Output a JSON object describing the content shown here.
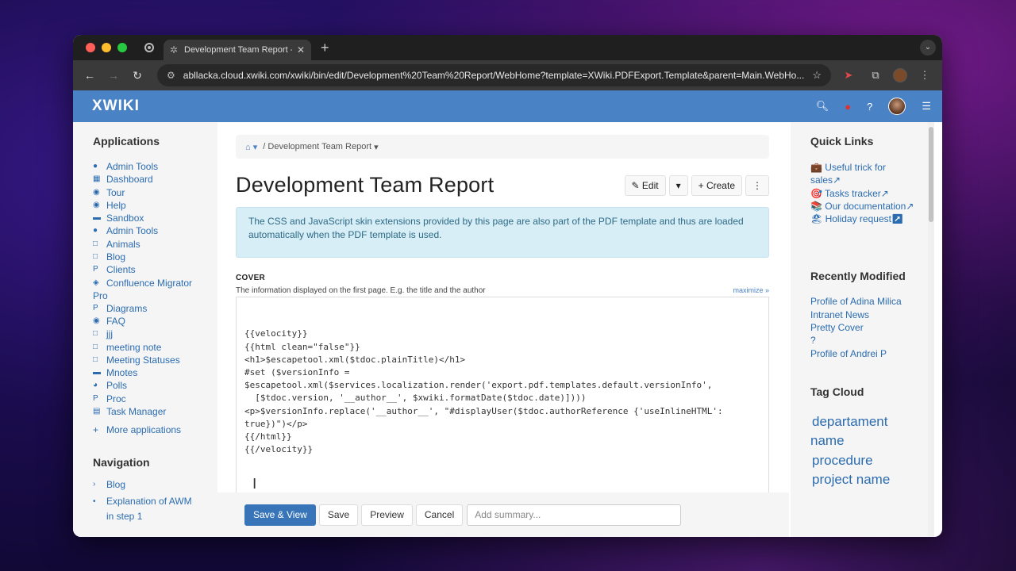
{
  "browser": {
    "tab_title": "Development Team Report - X",
    "new_tab": "+",
    "url": "abllacka.cloud.xwiki.com/xwiki/bin/edit/Development%20Team%20Report/WebHome?template=XWiki.PDFExport.Template&parent=Main.WebHo..."
  },
  "header": {
    "logo": "XWIKI"
  },
  "sidebar": {
    "applications_title": "Applications",
    "applications": [
      {
        "icon": "globe-icon",
        "label": "Admin Tools"
      },
      {
        "icon": "dashboard-icon",
        "label": "Dashboard"
      },
      {
        "icon": "tour-icon",
        "label": "Tour"
      },
      {
        "icon": "help-icon",
        "label": "Help"
      },
      {
        "icon": "sandbox-icon",
        "label": "Sandbox"
      },
      {
        "icon": "globe-icon",
        "label": "Admin Tools"
      },
      {
        "icon": "square-icon",
        "label": "Animals"
      },
      {
        "icon": "blog-icon",
        "label": "Blog"
      },
      {
        "icon": "p-icon",
        "label": "Clients"
      },
      {
        "icon": "confluence-icon",
        "label": "Confluence Migrator Pro"
      },
      {
        "icon": "p-icon",
        "label": "Diagrams"
      },
      {
        "icon": "faq-icon",
        "label": "FAQ"
      },
      {
        "icon": "square-icon",
        "label": "jjj"
      },
      {
        "icon": "square-icon",
        "label": "meeting note"
      },
      {
        "icon": "square-icon",
        "label": "Meeting Statuses"
      },
      {
        "icon": "mnotes-icon",
        "label": "Mnotes"
      },
      {
        "icon": "polls-icon",
        "label": "Polls"
      },
      {
        "icon": "p-icon",
        "label": "Proc"
      },
      {
        "icon": "task-icon",
        "label": "Task Manager"
      }
    ],
    "more_applications": "More applications",
    "navigation_title": "Navigation",
    "navigation": [
      "Blog",
      "Explanation of AWM in step 1"
    ]
  },
  "main": {
    "breadcrumb": "Development Team Report",
    "title": "Development Team Report",
    "edit": "Edit",
    "create": "Create",
    "notice": "The CSS and JavaScript skin extensions provided by this page are also part of the PDF template and thus are loaded automatically when the PDF template is used.",
    "section_title": "COVER",
    "section_desc": "The information displayed on the first page. E.g. the title and the author",
    "maximize": "maximize »",
    "code": "{{velocity}}\n{{html clean=\"false\"}}\n<h1>$escapetool.xml($tdoc.plainTitle)</h1>\n#set ($versionInfo =\n$escapetool.xml($services.localization.render('export.pdf.templates.default.versionInfo',\n  [$tdoc.version, '__author__', $xwiki.formatDate($tdoc.date)])))\n<p>$versionInfo.replace('__author__', \"#displayUser($tdoc.authorReference {'useInlineHTML':\ntrue})\")</p>\n{{/html}}\n{{/velocity}}",
    "buttons": {
      "save_view": "Save & View",
      "save": "Save",
      "preview": "Preview",
      "cancel": "Cancel",
      "summary_placeholder": "Add summary..."
    }
  },
  "right": {
    "quick_links_title": "Quick Links",
    "quick_links": [
      "💼 Useful trick for sales↗",
      "🎯 Tasks tracker↗",
      "📚 Our documentation↗",
      "🏖 Holiday request↗"
    ],
    "recent_title": "Recently Modified",
    "recent": [
      "Profile of Adina Milica",
      "Intranet News",
      "Pretty Cover",
      "?",
      "Profile of Andrei P"
    ],
    "tag_title": "Tag Cloud",
    "tags": [
      "departament",
      "name",
      "procedure",
      "project name"
    ]
  }
}
